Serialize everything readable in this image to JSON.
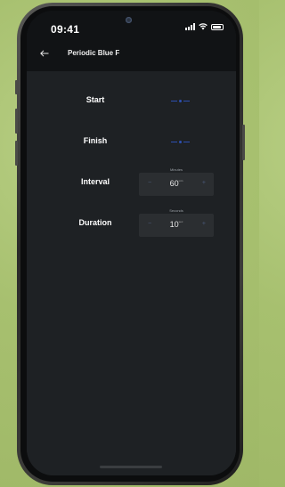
{
  "status_bar": {
    "time": "09:41"
  },
  "app_bar": {
    "back_icon": "arrow-left-icon",
    "title": "Periodic Blue F"
  },
  "rows": {
    "start": {
      "label": "Start",
      "picker_value": "--:--",
      "picker_color": "#2d4fb0"
    },
    "finish": {
      "label": "Finish",
      "picker_value": "--:--",
      "picker_color": "#2d4fb0"
    },
    "interval": {
      "label": "Interval",
      "caption": "Minutes",
      "value": "60",
      "unit": "min",
      "decrement_icon": "minus-icon",
      "increment_icon": "plus-icon"
    },
    "duration": {
      "label": "Duration",
      "caption": "Seconds",
      "value": "10",
      "unit": "sec",
      "decrement_icon": "minus-icon",
      "increment_icon": "plus-icon"
    }
  },
  "colors": {
    "background": "#1e2124",
    "bar": "#111315",
    "accent_blue": "#2d4fb0",
    "stepper_bg": "#2b2e31",
    "phone_backdrop": "#a7c06f"
  }
}
